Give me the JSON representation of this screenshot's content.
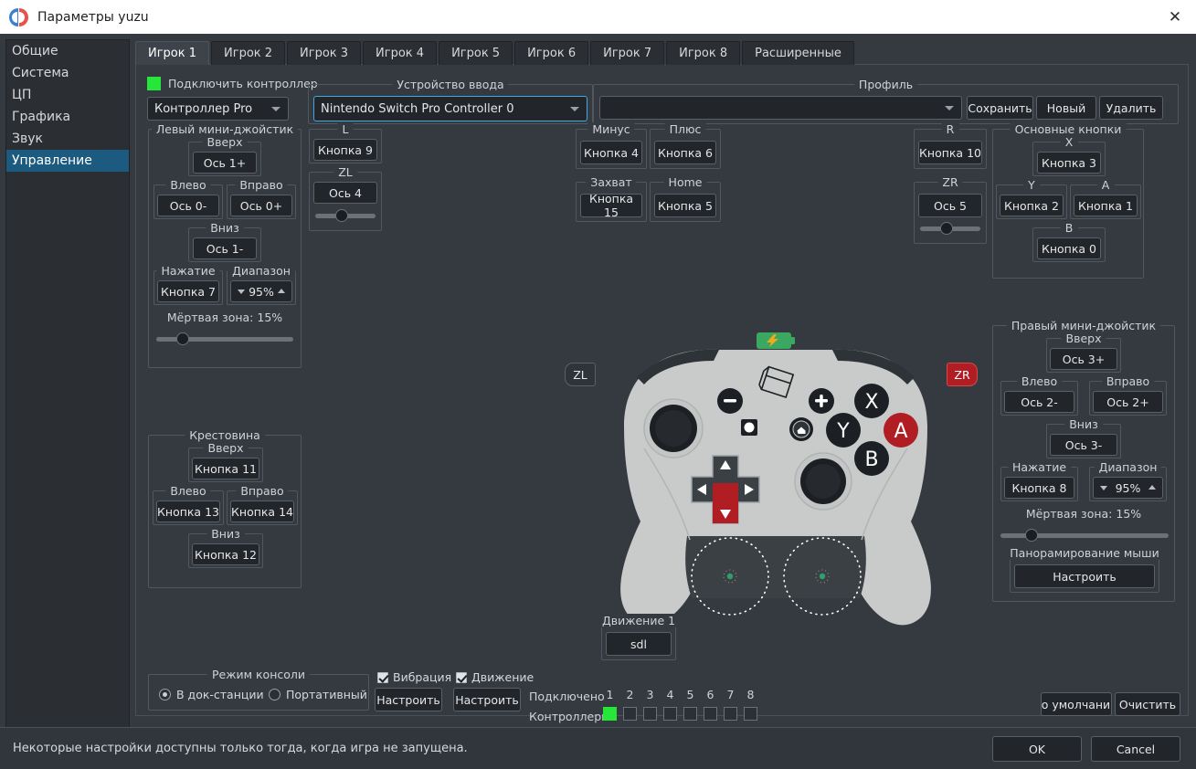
{
  "window": {
    "title": "Параметры yuzu",
    "close_icon": "close-icon"
  },
  "sidebar": {
    "items": [
      {
        "label": "Общие",
        "selected": false
      },
      {
        "label": "Система",
        "selected": false
      },
      {
        "label": "ЦП",
        "selected": false
      },
      {
        "label": "Графика",
        "selected": false
      },
      {
        "label": "Звук",
        "selected": false
      },
      {
        "label": "Управление",
        "selected": true
      }
    ]
  },
  "tabs": [
    {
      "label": "Игрок 1",
      "active": true
    },
    {
      "label": "Игрок 2",
      "active": false
    },
    {
      "label": "Игрок 3",
      "active": false
    },
    {
      "label": "Игрок 4",
      "active": false
    },
    {
      "label": "Игрок 5",
      "active": false
    },
    {
      "label": "Игрок 6",
      "active": false
    },
    {
      "label": "Игрок 7",
      "active": false
    },
    {
      "label": "Игрок 8",
      "active": false
    },
    {
      "label": "Расширенные",
      "active": false
    }
  ],
  "top": {
    "connect_label": "Подключить контроллер",
    "connect_on": true,
    "controller_type": "Контроллер Pro",
    "input_device_group": "Устройство ввода",
    "input_device_value": "Nintendo Switch Pro Controller 0",
    "profile_group": "Профиль",
    "profile_value": "",
    "profile_save": "Сохранить",
    "profile_new": "Новый",
    "profile_delete": "Удалить"
  },
  "left_stick": {
    "group": "Левый мини-джойстик",
    "up_label": "Вверх",
    "up_value": "Ось 1+",
    "left_label": "Влево",
    "left_value": "Ось 0-",
    "right_label": "Вправо",
    "right_value": "Ось 0+",
    "down_label": "Вниз",
    "down_value": "Ось 1-",
    "press_label": "Нажатие",
    "press_value": "Кнопка 7",
    "range_label": "Диапазон",
    "range_value": "95%",
    "deadzone_label": "Мёртвая зона: 15%",
    "deadzone_percent": 15
  },
  "shoulder_left": {
    "l_label": "L",
    "l_value": "Кнопка 9",
    "zl_label": "ZL",
    "zl_value": "Ось 4",
    "zl_slider_percent": 33
  },
  "center_buttons": {
    "minus_label": "Минус",
    "minus_value": "Кнопка 4",
    "plus_label": "Плюс",
    "plus_value": "Кнопка 6",
    "capture_label": "Захват",
    "capture_value": "Кнопка 15",
    "home_label": "Home",
    "home_value": "Кнопка 5"
  },
  "shoulder_right": {
    "r_label": "R",
    "r_value": "Кнопка 10",
    "zr_label": "ZR",
    "zr_value": "Ось 5",
    "zr_slider_percent": 33
  },
  "face_buttons": {
    "group": "Основные кнопки",
    "x_label": "X",
    "x_value": "Кнопка 3",
    "y_label": "Y",
    "y_value": "Кнопка 2",
    "a_label": "A",
    "a_value": "Кнопка 1",
    "b_label": "B",
    "b_value": "Кнопка 0"
  },
  "dpad": {
    "group": "Крестовина",
    "up_label": "Вверх",
    "up_value": "Кнопка 11",
    "left_label": "Влево",
    "left_value": "Кнопка 13",
    "right_label": "Вправо",
    "right_value": "Кнопка 14",
    "down_label": "Вниз",
    "down_value": "Кнопка 12"
  },
  "right_stick": {
    "group": "Правый мини-джойстик",
    "up_label": "Вверх",
    "up_value": "Ось 3+",
    "left_label": "Влево",
    "left_value": "Ось 2-",
    "right_label": "Вправо",
    "right_value": "Ось 2+",
    "down_label": "Вниз",
    "down_value": "Ось 3-",
    "press_label": "Нажатие",
    "press_value": "Кнопка 8",
    "range_label": "Диапазон",
    "range_value": "95%",
    "deadzone_label": "Мёртвая зона: 15%",
    "deadzone_percent": 15,
    "mouse_pan_label": "Панорамирование мыши",
    "mouse_pan_button": "Настроить"
  },
  "motion": {
    "group": "Движение 1",
    "value": "sdl"
  },
  "bottom": {
    "console_mode_group": "Режим консоли",
    "docked_label": "В док-станции",
    "docked_selected": true,
    "handheld_label": "Портативный",
    "handheld_selected": false,
    "vibration_label": "Вибрация",
    "vibration_checked": true,
    "vibration_button": "Настроить",
    "motion_label": "Движение",
    "motion_checked": true,
    "motion_button": "Настроить",
    "connected_label": "Подключено",
    "controllers_label": "Контроллеры",
    "port_numbers": [
      "1",
      "2",
      "3",
      "4",
      "5",
      "6",
      "7",
      "8"
    ],
    "port_states": [
      true,
      false,
      false,
      false,
      false,
      false,
      false,
      false
    ],
    "defaults_button": "По умолчанию",
    "clear_button": "Очистить"
  },
  "footer": {
    "note": "Некоторые настройки доступны только тогда, когда игра не запущена.",
    "ok": "OK",
    "cancel": "Cancel"
  },
  "controller_art": {
    "zl_overlay": "ZL",
    "zr_overlay": "ZR",
    "zr_active": true,
    "face_x": "X",
    "face_y": "Y",
    "face_a": "A",
    "face_b": "B",
    "a_active": true,
    "battery_icon": "battery-charging-icon",
    "home_icon": "home-icon",
    "minus_icon": "minus-icon",
    "plus_icon": "plus-icon",
    "capture_icon": "capture-circle-icon",
    "colors": {
      "body": "#c9cbcb",
      "accent_red": "#b01e24",
      "battery_green": "#3aa860",
      "battery_bolt": "#f0a81e"
    }
  }
}
